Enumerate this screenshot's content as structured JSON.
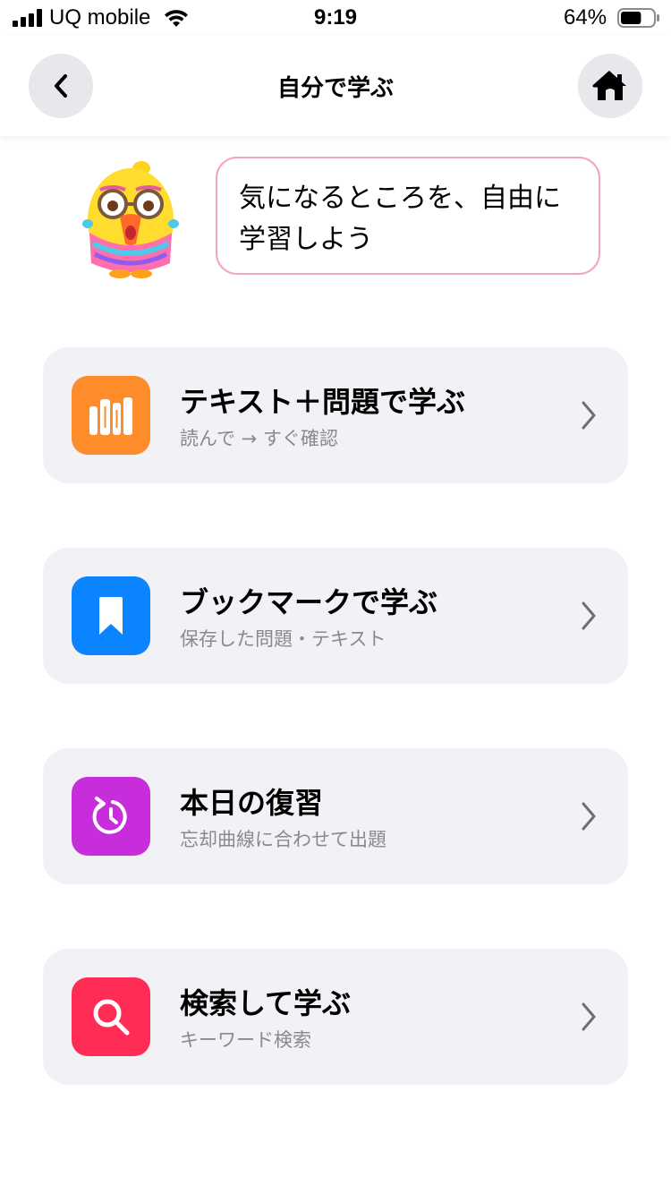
{
  "status_bar": {
    "carrier": "UQ mobile",
    "time": "9:19",
    "battery_percent": "64%",
    "battery_level": 0.64
  },
  "nav": {
    "title": "自分で学ぶ",
    "back_icon": "chevron-left-icon",
    "home_icon": "home-icon"
  },
  "hero": {
    "message": "気になるところを、自由に学習しよう"
  },
  "menu": [
    {
      "title": "テキスト＋問題で学ぶ",
      "subtitle": "読んで → すぐ確認",
      "icon": "books-icon",
      "color": "#ff8c2a"
    },
    {
      "title": "ブックマークで学ぶ",
      "subtitle": "保存した問題・テキスト",
      "icon": "bookmark-icon",
      "color": "#0a84ff"
    },
    {
      "title": "本日の復習",
      "subtitle": "忘却曲線に合わせて出題",
      "icon": "review-icon",
      "color": "#c82ddb"
    },
    {
      "title": "検索して学ぶ",
      "subtitle": "キーワード検索",
      "icon": "search-icon",
      "color": "#ff2d55"
    }
  ]
}
